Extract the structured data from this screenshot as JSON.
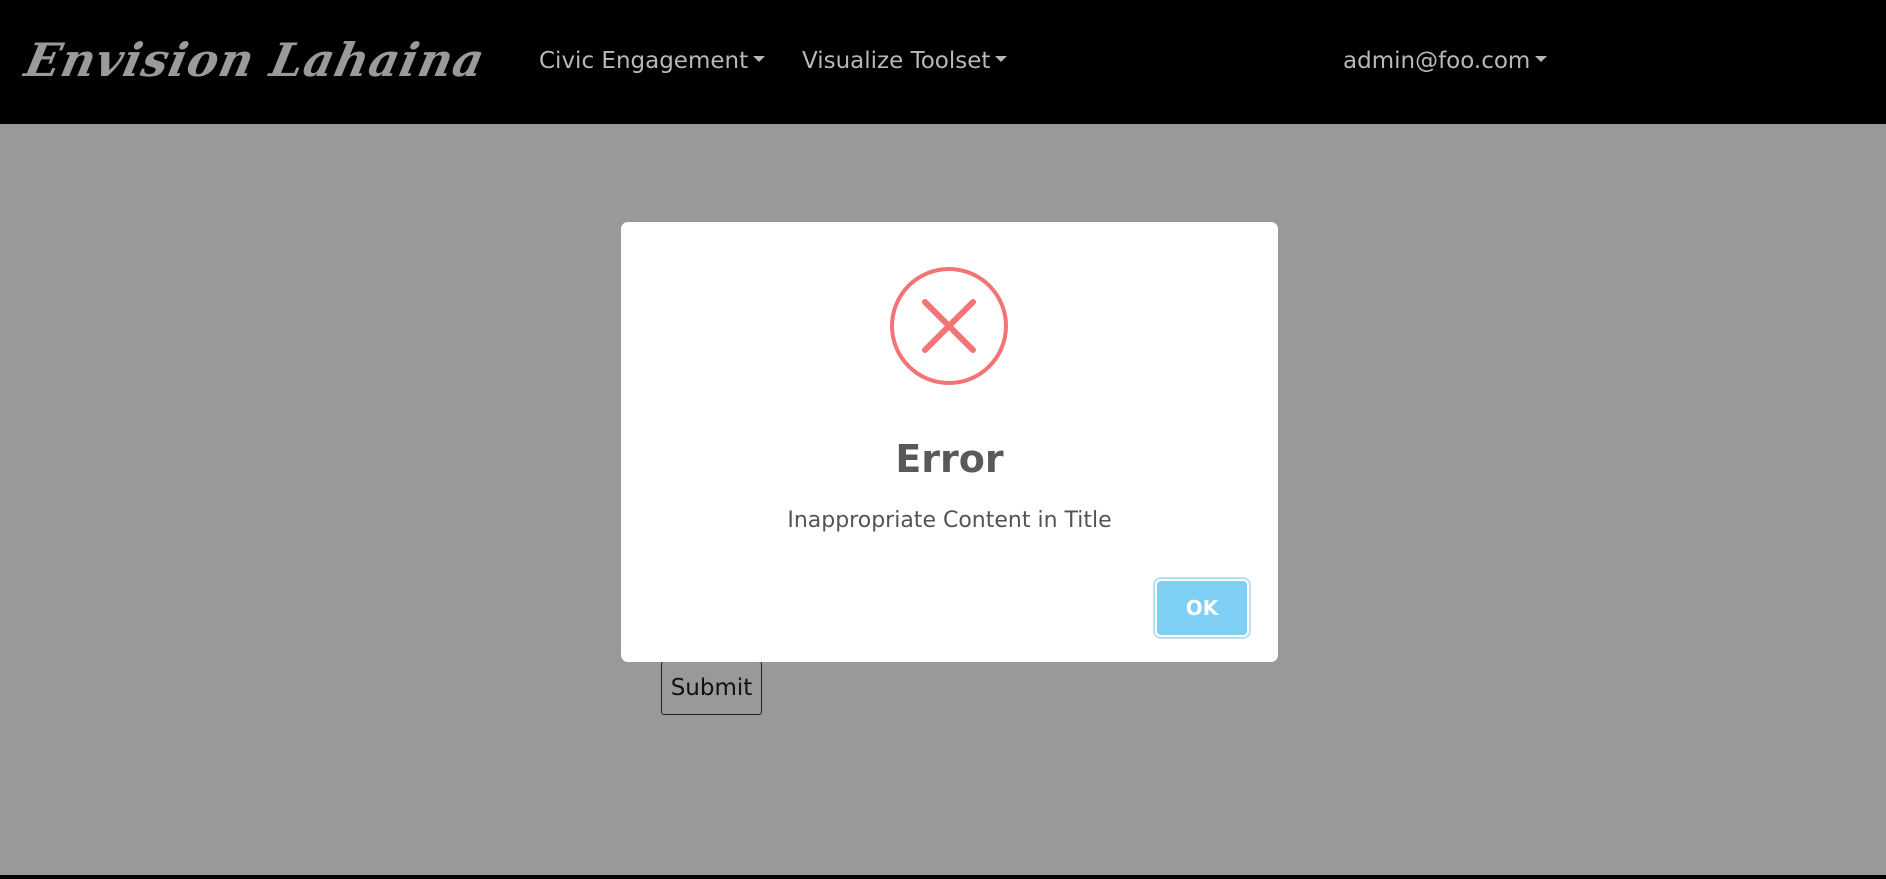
{
  "navbar": {
    "brand": "Envision Lahaina",
    "items": [
      {
        "label": "Civic Engagement"
      },
      {
        "label": "Visualize Toolset"
      }
    ],
    "user": "admin@foo.com"
  },
  "form": {
    "submit_label": "Submit"
  },
  "modal": {
    "icon": "error-x-icon",
    "title": "Error",
    "message": "Inappropriate Content in Title",
    "ok_label": "OK"
  },
  "colors": {
    "navbar_bg": "#000000",
    "overlay_bg": "#999999",
    "error_icon": "#f27474",
    "ok_button": "#7ecff4"
  }
}
